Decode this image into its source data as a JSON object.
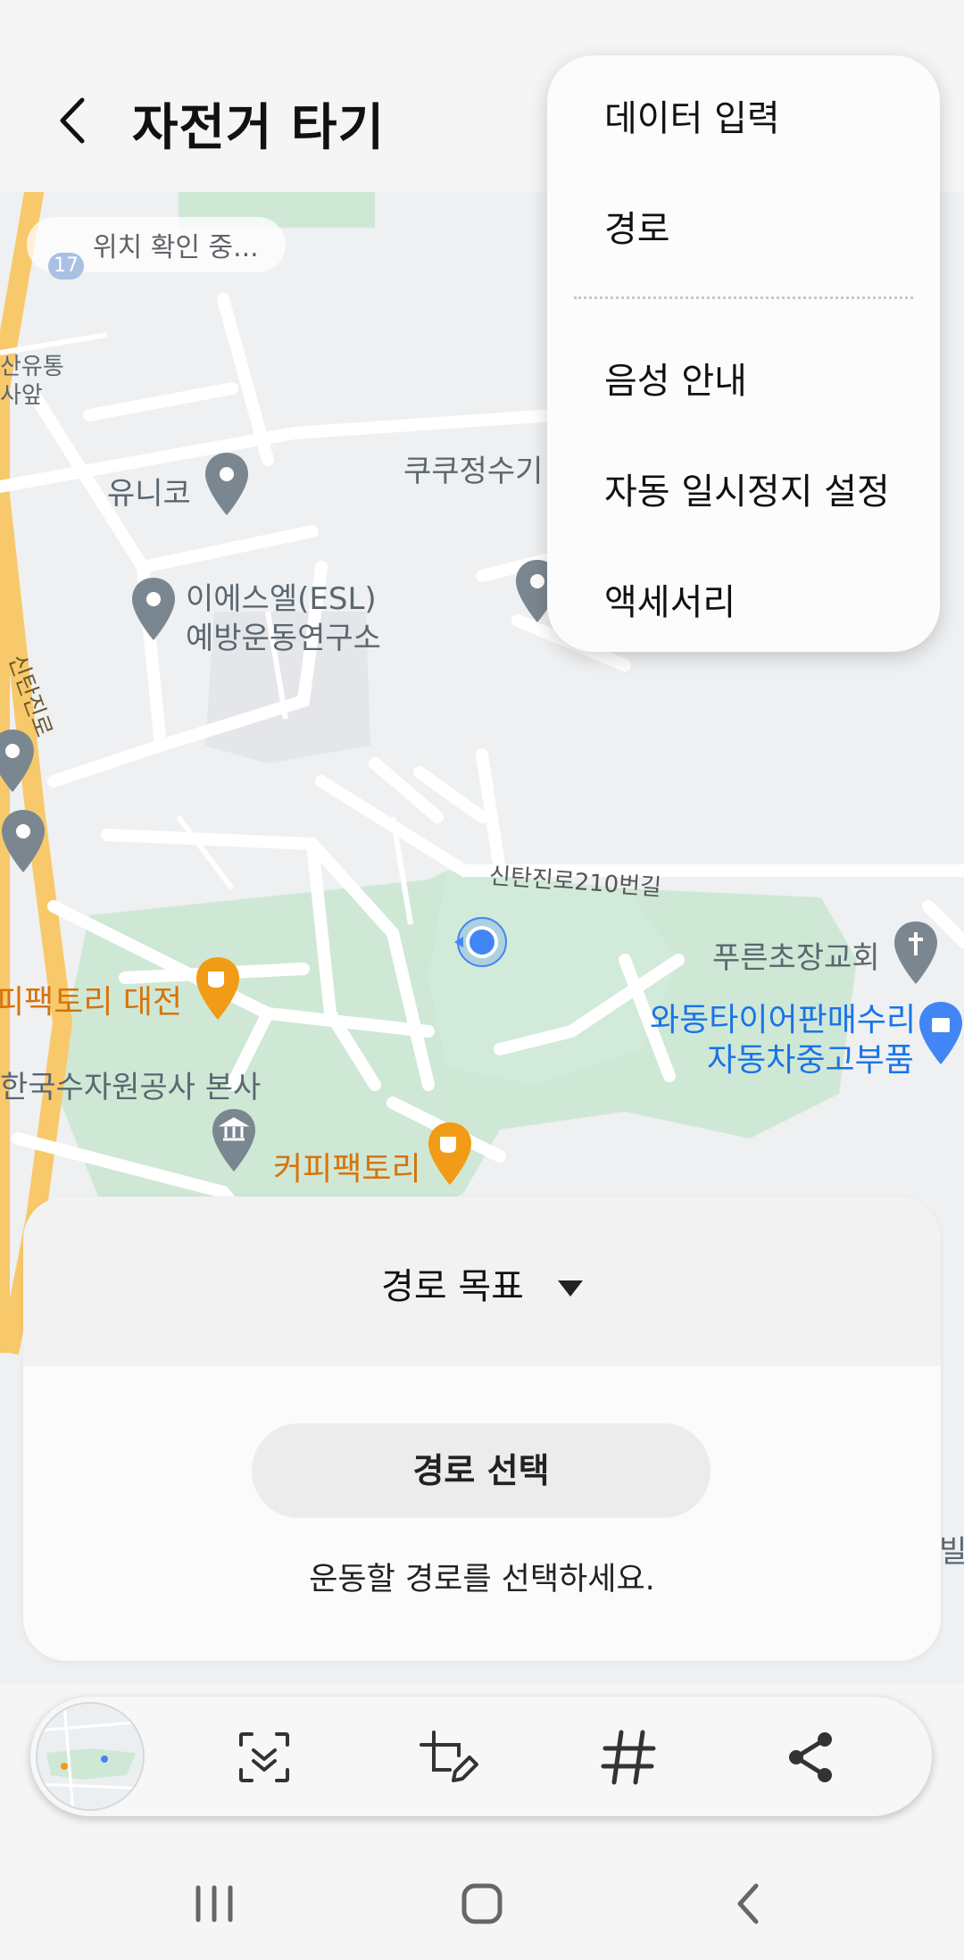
{
  "header": {
    "title": "자전거 타기",
    "back_icon": "back-chevron-icon"
  },
  "map": {
    "location_status": "위치 확인 중...",
    "location_badge": "17",
    "labels": {
      "unico": "유니코",
      "kukujeongsu": "쿠쿠정수기",
      "esl_line1": "이에스엘(ESL)",
      "esl_line2": "예방운동연구소",
      "sanyutong_line1": "산유통",
      "sanyutong_line2": "사앞",
      "road_vertical": "신탄진로",
      "road_210": "신탄진로210번길",
      "church": "푸른초장교회",
      "tire_line1": "와동타이어판매수리",
      "tire_line2": "자동차중고부품",
      "coffee_daejeon": "피팩토리 대전",
      "water_corp": "한국수자원공사 본사",
      "coffee_factory": "커피팩토리",
      "edge_right": "빌"
    },
    "colors": {
      "park": "#cfe8d6",
      "road": "#ffffff",
      "highway": "#f8c96a",
      "poi_orange": "#f29b16",
      "poi_gray": "#7b8790",
      "poi_blue": "#4285f4"
    }
  },
  "menu": {
    "items": [
      "데이터 입력",
      "경로",
      "음성 안내",
      "자동 일시정지 설정",
      "액세서리"
    ]
  },
  "panel": {
    "goal_label": "경로 목표",
    "select_route_button": "경로 선택",
    "hint": "운동할 경로를 선택하세요."
  },
  "toolbar": {
    "icons": [
      "scroll-capture-icon",
      "edit-crop-icon",
      "hashtag-icon",
      "share-icon"
    ]
  },
  "navbar": {
    "icons": [
      "recent-apps-icon",
      "home-icon",
      "back-icon"
    ]
  }
}
